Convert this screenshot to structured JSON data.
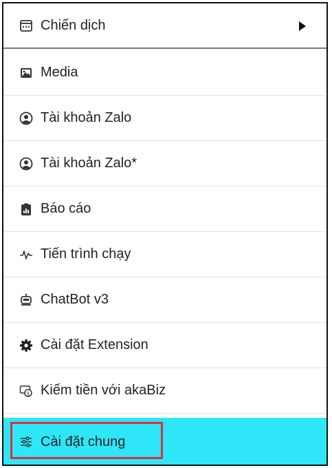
{
  "menu": {
    "items": [
      {
        "label": "Chiến dịch",
        "icon": "calendar-icon"
      },
      {
        "label": "Media",
        "icon": "image-icon"
      },
      {
        "label": "Tài khoản Zalo",
        "icon": "user-circle-icon"
      },
      {
        "label": "Tài khoản Zalo*",
        "icon": "user-circle-icon"
      },
      {
        "label": "Báo cáo",
        "icon": "report-icon"
      },
      {
        "label": "Tiến trình chạy",
        "icon": "pulse-icon"
      },
      {
        "label": "ChatBot v3",
        "icon": "robot-icon"
      },
      {
        "label": "Cài đặt Extension",
        "icon": "gear-icon"
      },
      {
        "label": "Kiếm tiền với akaBiz",
        "icon": "money-icon"
      },
      {
        "label": "Cài đặt chung",
        "icon": "sliders-icon"
      }
    ],
    "active_index": 9
  },
  "colors": {
    "active_background": "#2ee6f7",
    "highlight_border": "#d9303a",
    "text": "#222222"
  }
}
